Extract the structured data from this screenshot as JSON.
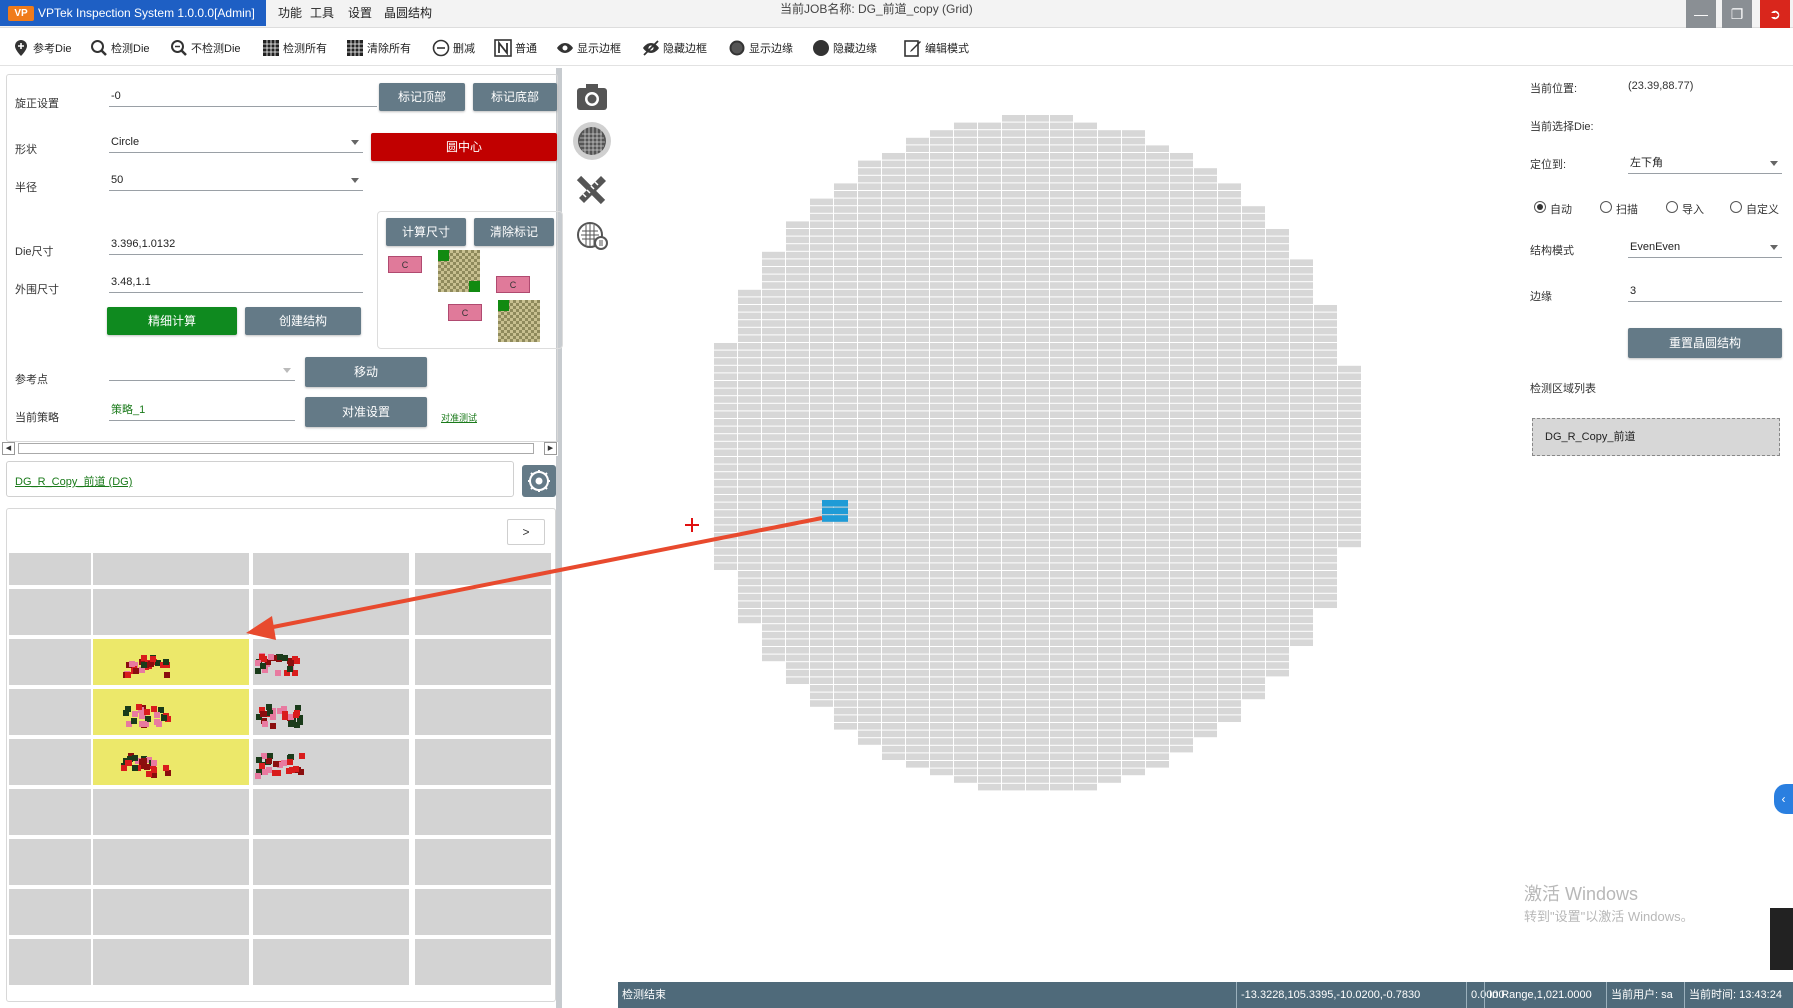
{
  "titlebar": {
    "app_title": "VPTek Inspection System 1.0.0.0[Admin]",
    "logo_text": "VP",
    "menus": [
      "功能",
      "工具",
      "设置",
      "晶圆结构"
    ],
    "job_title": "当前JOB名称: DG_前道_copy (Grid)"
  },
  "toolbar": {
    "items": [
      "参考Die",
      "检测Die",
      "不检测Die",
      "检测所有",
      "清除所有",
      "删减",
      "普通",
      "显示边框",
      "隐藏边框",
      "显示边缘",
      "隐藏边缘",
      "编辑模式"
    ]
  },
  "left": {
    "rotate_label": "旋正设置",
    "rotate_value": "-0",
    "mark_top": "标记顶部",
    "mark_bottom": "标记底部",
    "shape_label": "形状",
    "shape_value": "Circle",
    "circle_center": "圆中心",
    "radius_label": "半径",
    "radius_value": "50",
    "calc_size": "计算尺寸",
    "clear_mark": "清除标记",
    "die_size_label": "Die尺寸",
    "die_size_value": "3.396,1.0132",
    "outer_size_label": "外围尺寸",
    "outer_size_value": "3.48,1.1",
    "fine_calc": "精细计算",
    "create_struct": "创建结构",
    "ref_point_label": "参考点",
    "ref_point_value": "",
    "move": "移动",
    "strategy_label": "当前策略",
    "strategy_value": "策略_1",
    "align_settings": "对准设置",
    "align_test": "对准测试",
    "ctag": "C",
    "dg_link": "DG_R_Copy_前道 (DG)",
    "grid_next": ">"
  },
  "right": {
    "pos_label": "当前位置:",
    "pos_value": "(23.39,88.77)",
    "selected_die_label": "当前选择Die:",
    "locate_label": "定位到:",
    "locate_value": "左下角",
    "radios": [
      "自动",
      "扫描",
      "导入",
      "自定义"
    ],
    "struct_mode_label": "结构模式",
    "struct_mode_value": "EvenEven",
    "edge_label": "边缘",
    "edge_value": "3",
    "reset_button": "重置晶圆结构",
    "region_list_label": "检测区域列表",
    "region_item": "DG_R_Copy_前道"
  },
  "watermark": {
    "line1": "激活 Windows",
    "line2": "转到\"设置\"以激活 Windows。"
  },
  "statusbar": {
    "state": "检测结束",
    "coords": "-13.3228,105.3395,-10.0200,-0.7830",
    "value": "0.0000",
    "range": "In Range,1,021.0000",
    "user": "当前用户: sa",
    "time": "当前时间: 13:43:24"
  },
  "colors": {
    "accent": "#1e5fc4",
    "button": "#647a87",
    "green": "#0f8a1f",
    "red": "#c10000",
    "die": "#d7d7d7",
    "selected_die": "#1f9bd6",
    "arrow": "#e84a2e"
  }
}
